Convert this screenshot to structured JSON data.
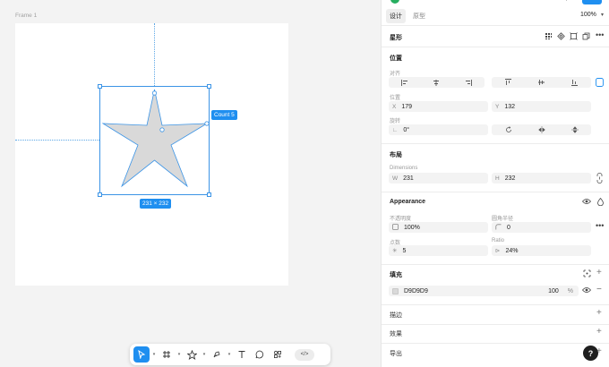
{
  "canvas": {
    "frame_label": "Frame 1",
    "count_badge": "Count 5",
    "dimensions_badge": "231 × 232",
    "star_fill": "#D9D9D9",
    "selection_color": "#3B94E6"
  },
  "toolbar": {
    "code_toggle": "</>"
  },
  "header": {
    "tabs": [
      "设计",
      "原型"
    ],
    "zoom": "100%"
  },
  "layer": {
    "name": "星形"
  },
  "position": {
    "title": "位置",
    "align_label": "对齐",
    "position_label": "位置",
    "x_label": "X",
    "x_value": "179",
    "y_label": "Y",
    "y_value": "132",
    "rotation_label": "旋转",
    "rotation_value": "0°"
  },
  "layout": {
    "title": "布局",
    "dimensions_label": "Dimensions",
    "w_label": "W",
    "w_value": "231",
    "h_label": "H",
    "h_value": "232"
  },
  "appearance": {
    "title": "Appearance",
    "opacity_label": "不透明度",
    "opacity_value": "100%",
    "radius_label": "圆角半径",
    "radius_value": "0",
    "count_label": "点数",
    "count_value": "5",
    "ratio_label": "Ratio",
    "ratio_value": "24%"
  },
  "fill": {
    "title": "填充",
    "hex": "D9D9D9",
    "opacity": "100",
    "unit": "%",
    "color": "#D9D9D9"
  },
  "stroke": {
    "title": "描边"
  },
  "effects": {
    "title": "效果"
  },
  "export": {
    "title": "导出"
  },
  "help": {
    "label": "?"
  }
}
